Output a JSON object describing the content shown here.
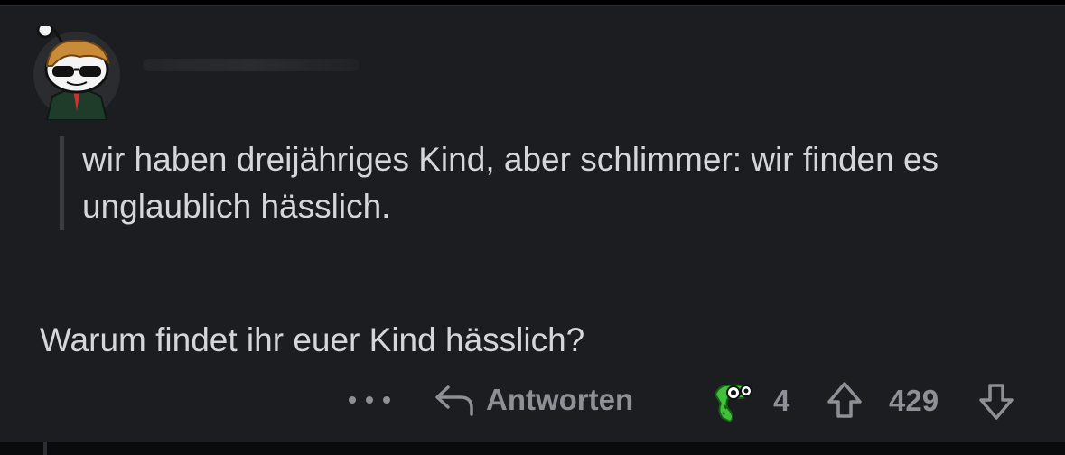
{
  "comment": {
    "avatar_icon": "snoo-avatar-icon",
    "quote": "wir haben dreijähriges Kind, aber schlimmer: wir finden es unglaublich hässlich.",
    "body": "Warum findet ihr euer Kind hässlich?"
  },
  "actions": {
    "more_icon": "more-dots-icon",
    "reply_label": "Antworten",
    "award_icon": "award-icon",
    "award_count": "4",
    "score": "429"
  },
  "colors": {
    "background": "#1b1d20",
    "text": "#d4d6d9",
    "muted": "#8d9096",
    "quote_bar": "#3a3c40",
    "award_green": "#3fbf3a"
  }
}
